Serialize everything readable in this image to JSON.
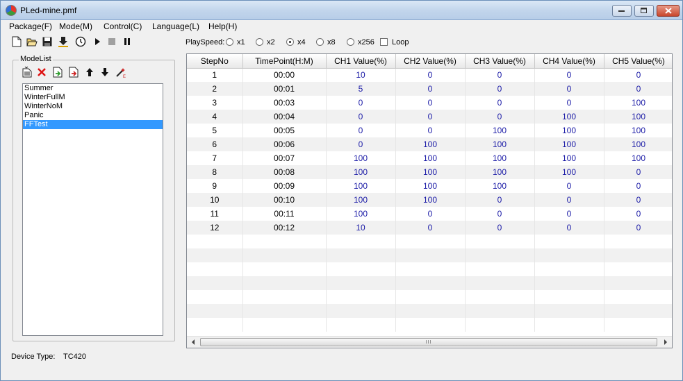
{
  "window": {
    "title": "PLed-mine.pmf"
  },
  "menu": [
    "Package(F)",
    "Mode(M)",
    "Control(C)",
    "Language(L)",
    "Help(H)"
  ],
  "toolbar": {
    "playspeed_label": "PlaySpeed:",
    "speeds": [
      {
        "label": "x1",
        "checked": false
      },
      {
        "label": "x2",
        "checked": false
      },
      {
        "label": "x4",
        "checked": true
      },
      {
        "label": "x8",
        "checked": false
      },
      {
        "label": "x256",
        "checked": false
      }
    ],
    "loop_label": "Loop",
    "loop_checked": false
  },
  "modelist": {
    "caption": "ModeList",
    "items": [
      "Summer",
      "WinterFullM",
      "WinterNoM",
      "Panic",
      "FFTest"
    ],
    "selected_index": 4
  },
  "device": {
    "label": "Device Type:",
    "value": "TC420"
  },
  "grid": {
    "columns": [
      "StepNo",
      "TimePoint(H:M)",
      "CH1 Value(%)",
      "CH2 Value(%)",
      "CH3 Value(%)",
      "CH4 Value(%)",
      "CH5 Value(%)"
    ],
    "rows": [
      [
        "1",
        "00:00",
        "10",
        "0",
        "0",
        "0",
        "0"
      ],
      [
        "2",
        "00:01",
        "5",
        "0",
        "0",
        "0",
        "0"
      ],
      [
        "3",
        "00:03",
        "0",
        "0",
        "0",
        "0",
        "100"
      ],
      [
        "4",
        "00:04",
        "0",
        "0",
        "0",
        "100",
        "100"
      ],
      [
        "5",
        "00:05",
        "0",
        "0",
        "100",
        "100",
        "100"
      ],
      [
        "6",
        "00:06",
        "0",
        "100",
        "100",
        "100",
        "100"
      ],
      [
        "7",
        "00:07",
        "100",
        "100",
        "100",
        "100",
        "100"
      ],
      [
        "8",
        "00:08",
        "100",
        "100",
        "100",
        "100",
        "0"
      ],
      [
        "9",
        "00:09",
        "100",
        "100",
        "100",
        "0",
        "0"
      ],
      [
        "10",
        "00:10",
        "100",
        "100",
        "0",
        "0",
        "0"
      ],
      [
        "11",
        "00:11",
        "100",
        "0",
        "0",
        "0",
        "0"
      ],
      [
        "12",
        "00:12",
        "10",
        "0",
        "0",
        "0",
        "0"
      ]
    ],
    "empty_rows": 7
  },
  "scrollbar": {
    "grip": "III"
  }
}
